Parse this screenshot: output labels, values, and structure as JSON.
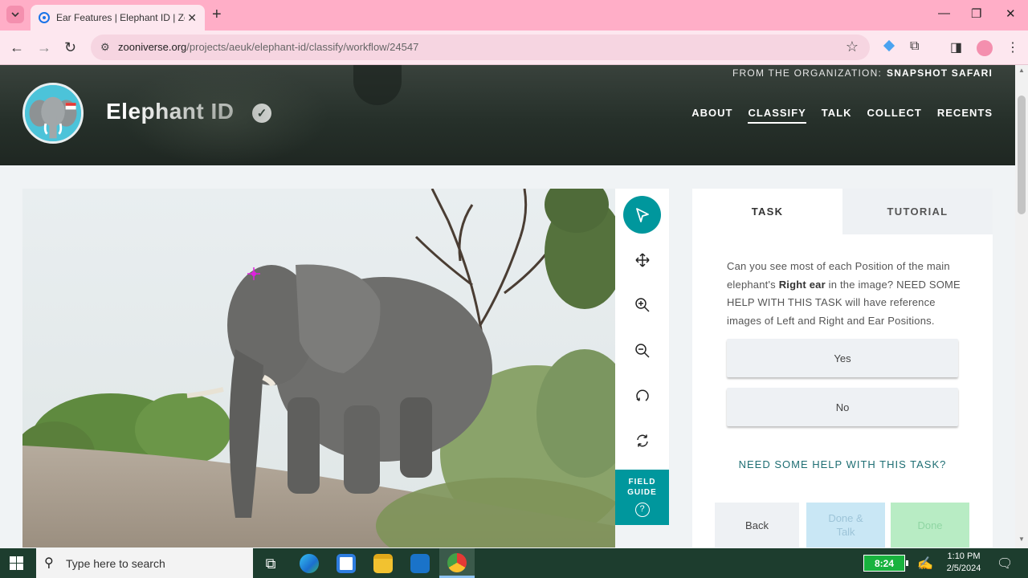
{
  "browser": {
    "tab_title": "Ear Features | Elephant ID | Zoo",
    "url_host": "zooniverse.org",
    "url_path": "/projects/aeuk/elephant-id/classify/workflow/24547"
  },
  "header": {
    "org_prefix": "FROM THE ORGANIZATION:",
    "org_name": "SNAPSHOT SAFARI",
    "project_title": "Elephant ID",
    "nav": [
      "ABOUT",
      "CLASSIFY",
      "TALK",
      "COLLECT",
      "RECENTS"
    ],
    "active_nav": "CLASSIFY"
  },
  "tools": {
    "items": [
      "pointer-icon",
      "move-icon",
      "zoom-in-icon",
      "zoom-out-icon",
      "rotate-icon",
      "reset-icon"
    ],
    "field_guide_line1": "FIELD",
    "field_guide_line2": "GUIDE",
    "field_guide_icon": "?"
  },
  "panel": {
    "tab_task": "TASK",
    "tab_tutorial": "TUTORIAL",
    "question_1": "Can you see most of each Position of the main elephant's ",
    "question_bold": "Right ear",
    "question_2": " in the image? NEED SOME HELP WITH THIS TASK will have reference images of Left and Right and Ear Positions.",
    "answers": [
      "Yes",
      "No"
    ],
    "help_link": "NEED SOME HELP WITH THIS TASK?",
    "back": "Back",
    "done_talk_1": "Done &",
    "done_talk_2": "Talk",
    "done": "Done"
  },
  "taskbar": {
    "search_placeholder": "Type here to search",
    "battery": "8:24",
    "time": "1:10 PM",
    "date": "2/5/2024"
  },
  "colors": {
    "teal_accent": "#00979d",
    "tabbar_pink": "#ffaec7",
    "hero_dark": "#26302a"
  }
}
